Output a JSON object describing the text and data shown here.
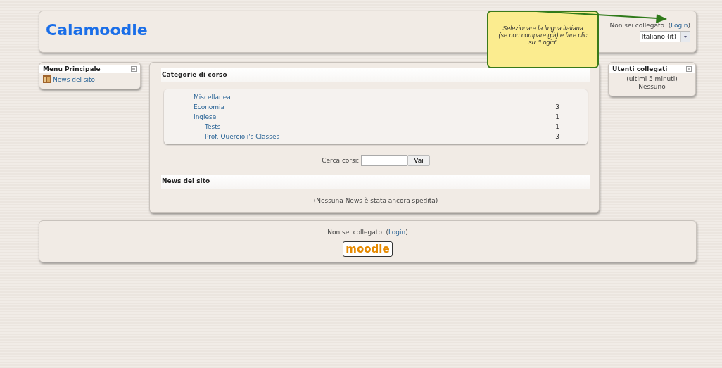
{
  "header": {
    "site_title": "Calamoodle",
    "login_info": {
      "text": "Non sei collegato. (",
      "link": "Login",
      "after": ")"
    },
    "language_select": {
      "value": "Italiano (it)"
    }
  },
  "callout": {
    "text": "Selezionare la lingua italiana (se non compare già) e fare clic su \"Login\""
  },
  "left_block": {
    "title": "Menu Principale",
    "items": [
      {
        "label": "News del sito"
      }
    ]
  },
  "main": {
    "categories_title": "Categorie di corso",
    "categories": [
      {
        "name": "Miscellanea"
      },
      {
        "name": "Economia",
        "count": "3"
      },
      {
        "name": "Inglese",
        "count": "1",
        "children": [
          {
            "name": "Tests",
            "count": "1"
          },
          {
            "name": "Prof. Quercioli's Classes",
            "count": "3"
          }
        ]
      }
    ],
    "search": {
      "label": "Cerca corsi:",
      "button": "Vai"
    },
    "news_title": "News del sito",
    "news_empty": "(Nessuna News è stata ancora spedita)"
  },
  "right_block": {
    "title": "Utenti collegati",
    "lines": [
      "(ultimi 5 minuti)",
      "Nessuno"
    ]
  },
  "footer": {
    "login_info": {
      "text": "Non sei collegato. (",
      "link": "Login",
      "after": ")"
    },
    "logo": "moodle"
  }
}
